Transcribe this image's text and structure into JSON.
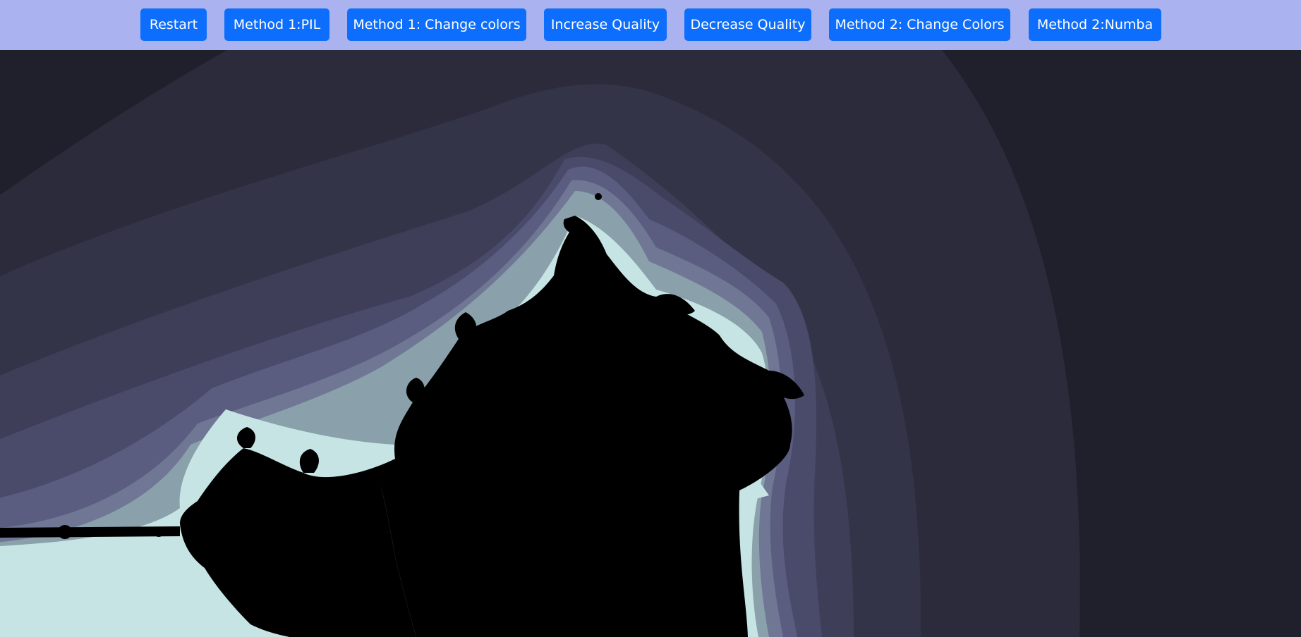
{
  "toolbar": {
    "buttons": [
      {
        "label": "Restart"
      },
      {
        "label": "Method 1:PIL"
      },
      {
        "label": "Method 1: Change colors"
      },
      {
        "label": "Increase Quality"
      },
      {
        "label": "Decrease Quality"
      },
      {
        "label": "Method 2: Change Colors"
      },
      {
        "label": "Method 2:Numba"
      }
    ]
  },
  "colors": {
    "toolbar_bg": "#aab3f0",
    "button_bg": "#0d6efd",
    "button_text": "#ffffff",
    "outer_bands": [
      "#20202c",
      "#2b2b3c",
      "#343449",
      "#3e3e58",
      "#4a4a6a",
      "#5a5d7f",
      "#6f7794",
      "#8aa0ab",
      "#c7e4e4"
    ],
    "set_interior": "#000000"
  }
}
